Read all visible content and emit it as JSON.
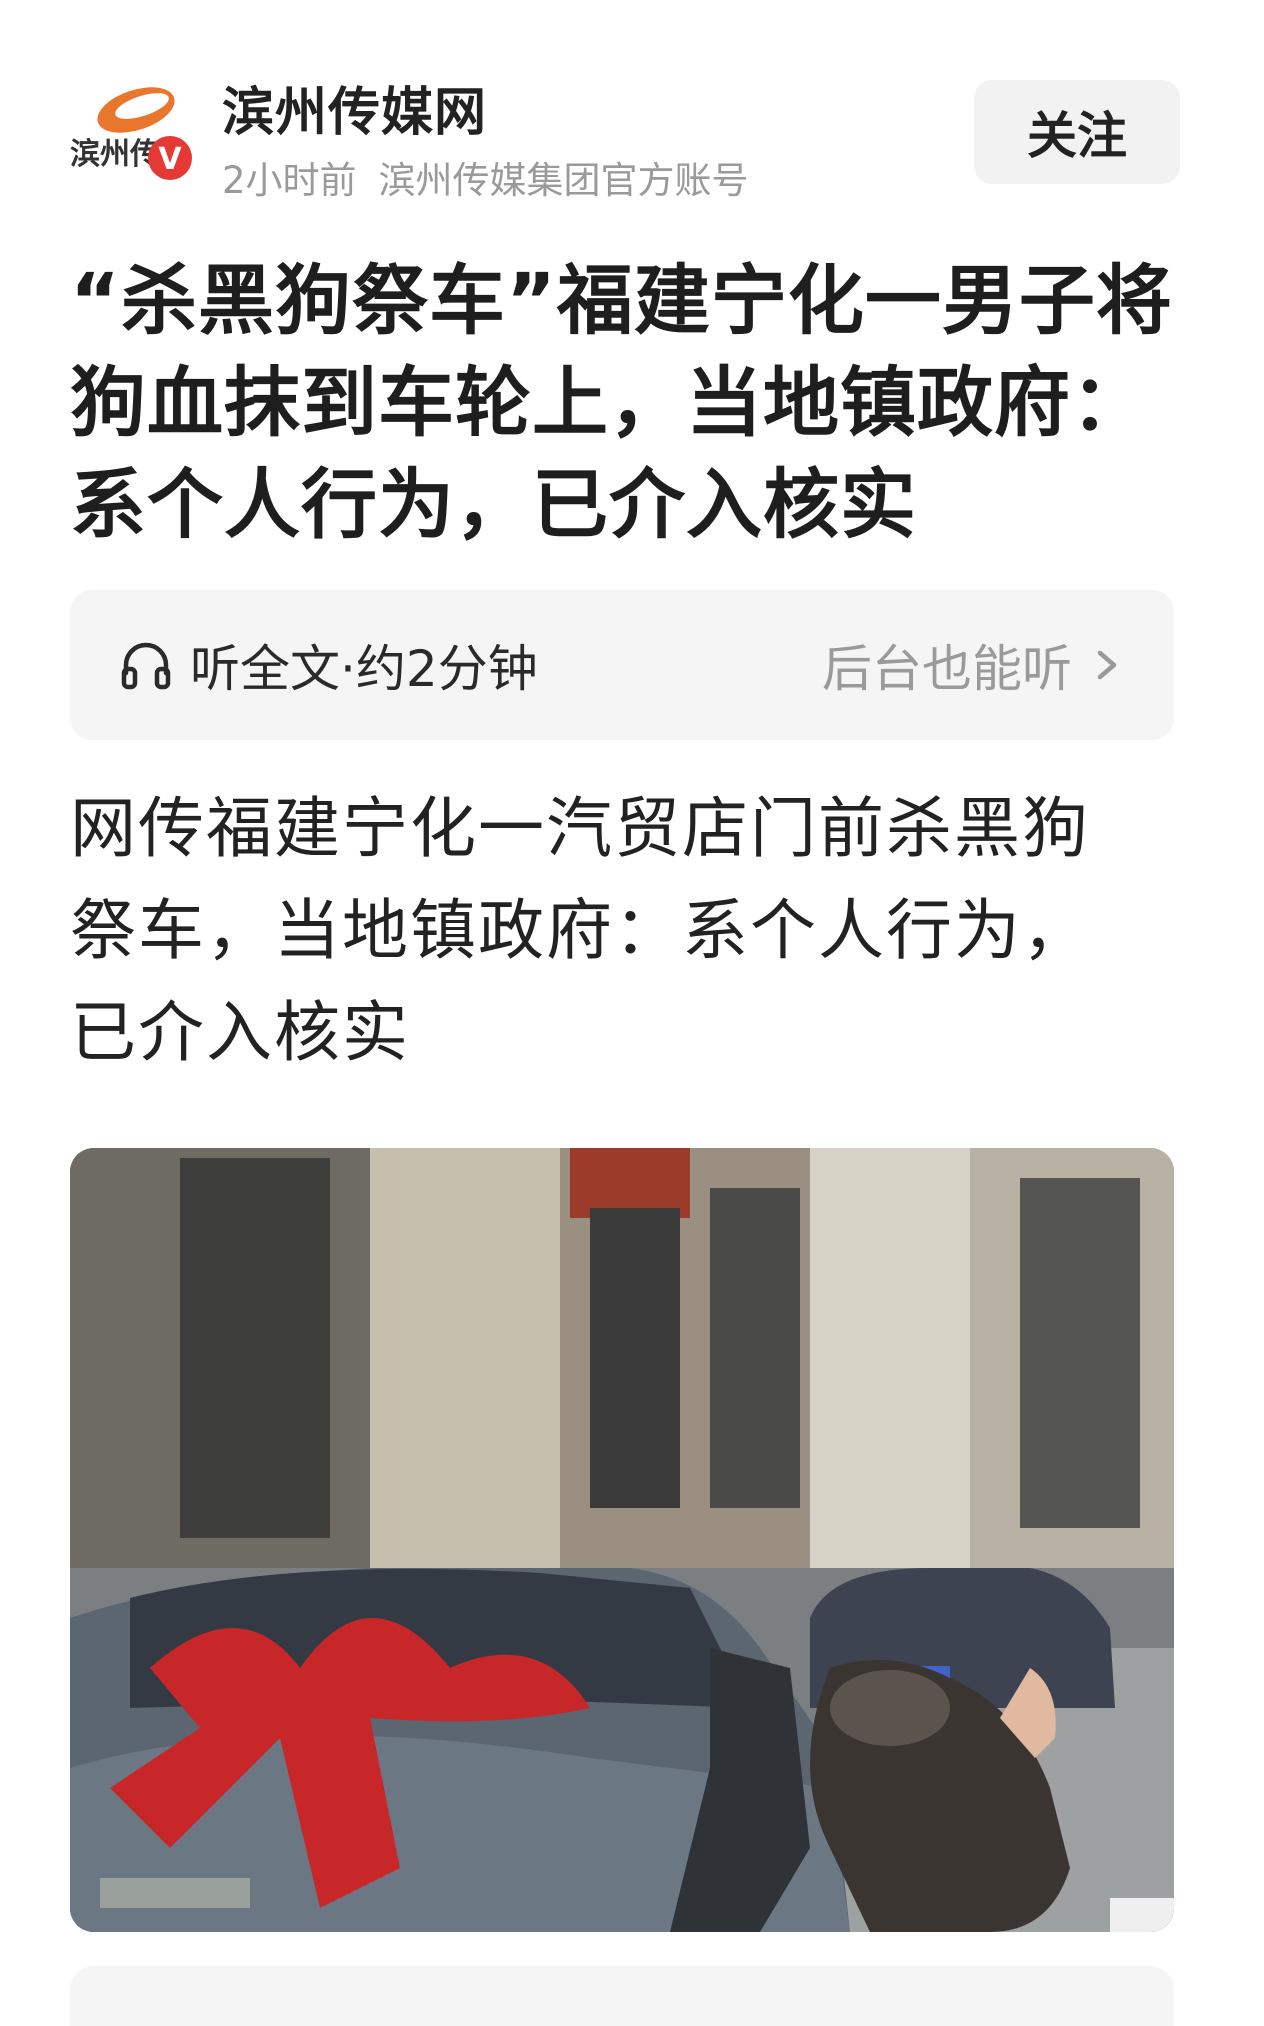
{
  "header": {
    "logo_text": "滨州传",
    "logo_badge": "V",
    "account_name": "滨州传媒网",
    "time": "2小时前",
    "account_desc": "滨州传媒集团官方账号",
    "follow_label": "关注"
  },
  "article": {
    "title_lines": [
      "“杀黑狗祭车”福建宁化一男子将",
      "狗血抹到车轮上，当地镇政府：",
      "系个人行为，已介入核实"
    ],
    "listen": {
      "label": "听全文·约2分钟",
      "background_label": "后台也能听"
    },
    "subtitle_lines": [
      "网传福建宁化一汽贸店门前杀黑狗",
      "祭车，当地镇政府：系个人行为，",
      "已介入核实"
    ],
    "image_icon": "news-photo"
  },
  "colors": {
    "accent_orange": "#e8762d",
    "badge_red": "#e53935",
    "ribbon_red": "#c8272a",
    "muted_text": "#9a9a9a",
    "card_bg": "#f5f5f5"
  }
}
